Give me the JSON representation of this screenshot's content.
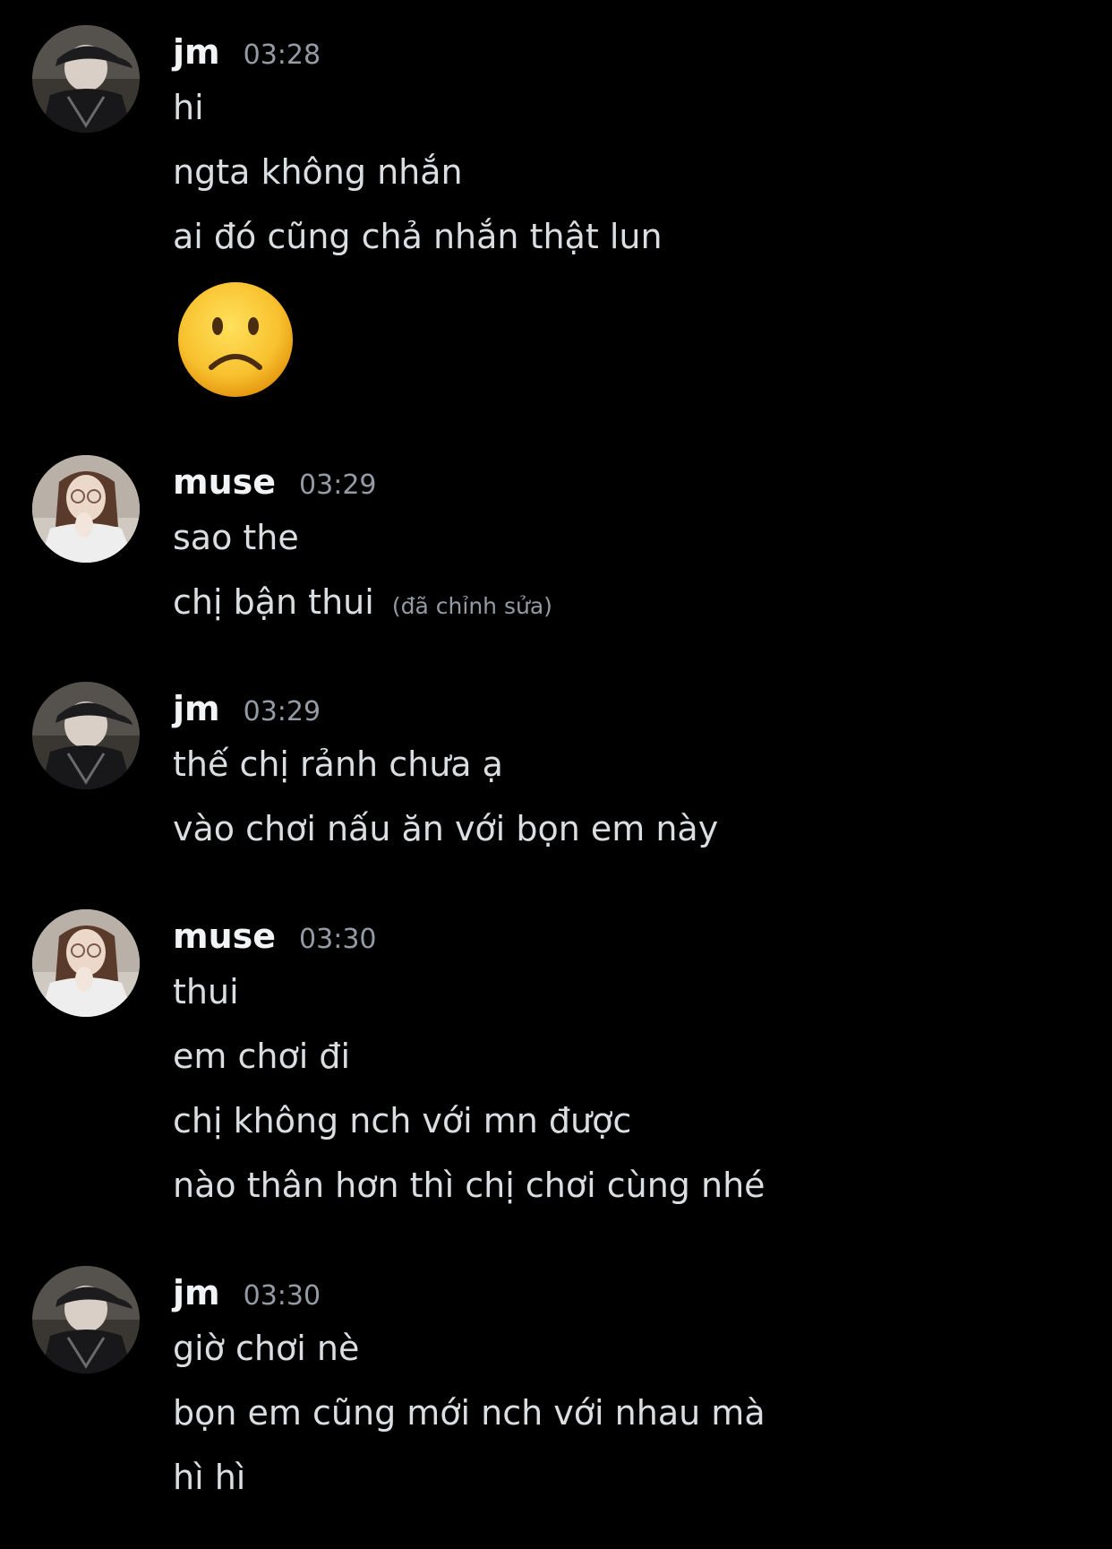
{
  "colors": {
    "background": "#000000",
    "username": "#f2f3f5",
    "message_text": "#dbdee1",
    "timestamp": "#949ba4",
    "edited": "#949ba4"
  },
  "messages": [
    {
      "username": "jm",
      "time": "03:28",
      "avatar_icon": "avatar-jm",
      "lines": [
        "hi",
        "ngta không nhắn",
        "ai đó cũng chả nhắn thật lun"
      ],
      "emoji": "slightly-frowning-face-icon"
    },
    {
      "username": "muse",
      "time": "03:29",
      "avatar_icon": "avatar-muse",
      "lines": [
        "sao the",
        "chị bận thui"
      ],
      "edited_label": "(đã chỉnh sửa)"
    },
    {
      "username": "jm",
      "time": "03:29",
      "avatar_icon": "avatar-jm",
      "lines": [
        "thế chị rảnh chưa ạ",
        "vào chơi nấu ăn với bọn em này"
      ]
    },
    {
      "username": "muse",
      "time": "03:30",
      "avatar_icon": "avatar-muse",
      "lines": [
        "thui",
        "em chơi đi",
        "chị không nch với mn được",
        "nào thân hơn thì chị chơi cùng nhé"
      ]
    },
    {
      "username": "jm",
      "time": "03:30",
      "avatar_icon": "avatar-jm",
      "lines": [
        "giờ chơi nè",
        "bọn em cũng mới nch với nhau mà",
        "hì hì"
      ]
    }
  ]
}
